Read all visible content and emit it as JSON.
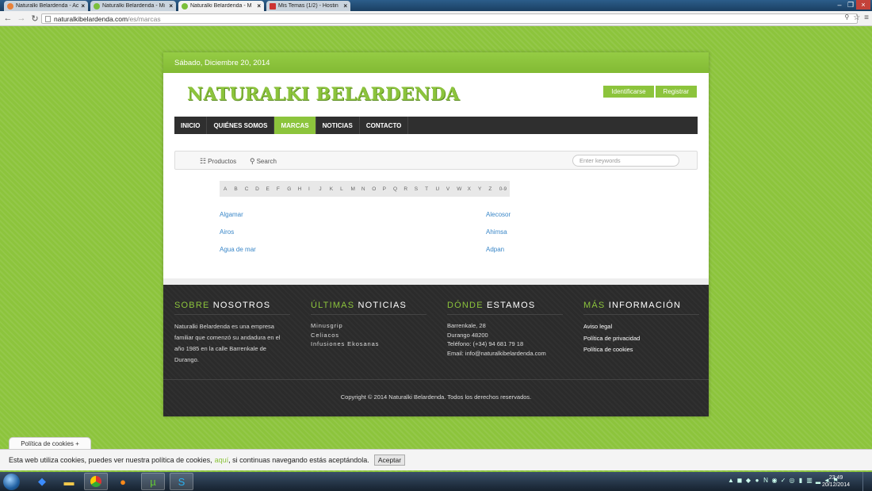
{
  "browser": {
    "tabs": [
      {
        "label": "Naturalki Belardenda - Ac"
      },
      {
        "label": "Naturalki Belardenda - Mi"
      },
      {
        "label": "Naturalki Belardenda - M"
      },
      {
        "label": "Mis Temas (1/2) - Hostin"
      }
    ],
    "url_host": "naturalkibelardenda.com",
    "url_path": "/es/marcas"
  },
  "site": {
    "date": "Sábado, Diciembre 20, 2014",
    "logo": "NATURALKI BELARDENDA",
    "login_label": "Identificarse",
    "register_label": "Registrar",
    "nav": [
      "INICIO",
      "QUIÉNES SOMOS",
      "MARCAS",
      "NOTICIAS",
      "CONTACTO"
    ],
    "search": {
      "products_label": "Productos",
      "search_label": "Search",
      "placeholder": "Enter keywords"
    },
    "alphabet": [
      "A",
      "B",
      "C",
      "D",
      "E",
      "F",
      "G",
      "H",
      "I",
      "J",
      "K",
      "L",
      "M",
      "N",
      "O",
      "P",
      "Q",
      "R",
      "S",
      "T",
      "U",
      "V",
      "W",
      "X",
      "Y",
      "Z",
      "0-9"
    ],
    "brands_left": [
      "Algamar",
      "Airos",
      "Agua de mar"
    ],
    "brands_right": [
      "Alecosor",
      "Ahimsa",
      "Adpan"
    ]
  },
  "footer": {
    "about": {
      "head_green": "SOBRE",
      "head_white": "NOSOTROS",
      "text": "Naturalki Belardenda es una empresa familiar que comenzó su andadura  en el año 1985 en la calle Barrenkale de Durango."
    },
    "news": {
      "head_green": "ÚLTIMAS",
      "head_white": "NOTICIAS",
      "items": [
        "Minusgrip",
        "Celiacos",
        "Infusiones Ekosanas"
      ]
    },
    "where": {
      "head_green": "DÓNDE",
      "head_white": "ESTAMOS",
      "lines": [
        "Barrenkale, 28",
        "Durango 48200",
        "Teléfono: (+34) 94 681 79 18",
        "Email: info@naturalkibelardenda.com"
      ]
    },
    "info": {
      "head_green": "MÁS",
      "head_white": "INFORMACIÓN",
      "links": [
        "Aviso legal",
        "Política de privacidad",
        "Política de cookies"
      ]
    },
    "copyright": "Copyright © 2014 Naturalki Belardenda. Todos los derechos reservados."
  },
  "cookies": {
    "tab_label": "Política de cookies +",
    "text_before": "Esta web utiliza cookies, puedes ver nuestra política de cookies,",
    "link": "aquí",
    "text_after": ", si continuas navegando estás aceptándola.",
    "accept_label": "Aceptar"
  },
  "taskbar": {
    "time": "23:49",
    "date": "20/12/2014"
  }
}
